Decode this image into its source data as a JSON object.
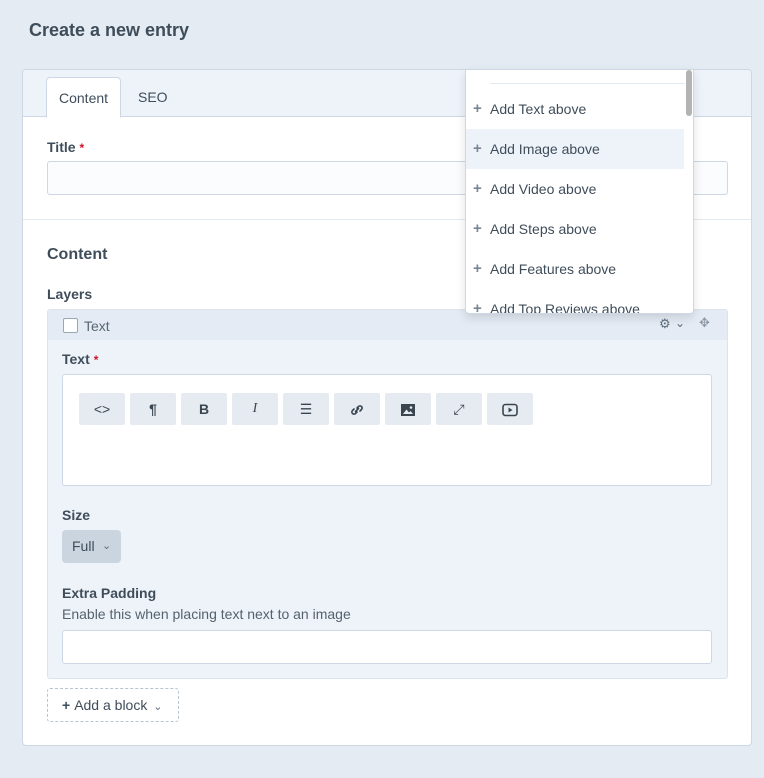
{
  "page": {
    "title": "Create a new entry"
  },
  "tabs": [
    {
      "label": "Content",
      "active": true
    },
    {
      "label": "SEO",
      "active": false
    }
  ],
  "title_field": {
    "label": "Title",
    "required_mark": "*",
    "value": ""
  },
  "content_section": {
    "title": "Content",
    "layers_label": "Layers",
    "block": {
      "title": "Text",
      "text_label": "Text",
      "required_mark": "*",
      "toolbar": [
        {
          "name": "code-icon",
          "glyph": "<>"
        },
        {
          "name": "paragraph-icon",
          "glyph": "¶"
        },
        {
          "name": "bold-icon",
          "glyph": "B"
        },
        {
          "name": "italic-icon",
          "glyph": "I"
        },
        {
          "name": "list-icon",
          "glyph": "☰"
        },
        {
          "name": "link-icon",
          "glyph": "🔗"
        },
        {
          "name": "image-icon",
          "glyph": "▣"
        },
        {
          "name": "fullscreen-icon",
          "glyph": "⤢"
        },
        {
          "name": "video-icon",
          "glyph": "▶"
        }
      ],
      "size": {
        "label": "Size",
        "value": "Full"
      },
      "extra_padding": {
        "label": "Extra Padding",
        "hint": "Enable this when placing text next to an image",
        "value": ""
      }
    },
    "add_block_label": "Add a block"
  },
  "dropdown": {
    "items": [
      "Add Text above",
      "Add Image above",
      "Add Video above",
      "Add Steps above",
      "Add Features above",
      "Add Top Reviews above"
    ],
    "hovered_index": 1
  }
}
